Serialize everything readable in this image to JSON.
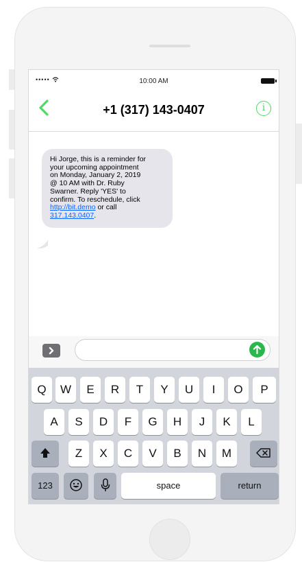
{
  "status_bar": {
    "signal": "••••• ",
    "time": "10:00 AM"
  },
  "nav": {
    "contact": "+1 (317) 143-0407",
    "info_icon": "info-icon"
  },
  "message": {
    "text_lines": [
      "Hi Jorge, this is a reminder for",
      "your upcoming appointment",
      "on Monday, January 2, 2019",
      "@ 10 AM with Dr. Ruby",
      "Swarner. Reply 'YES' to",
      "confirm. To reschedule, click"
    ],
    "link_url": "http://bit.demo",
    "text_or_call": " or call",
    "link_phone": "317.143.0407",
    "trailing": "."
  },
  "keyboard": {
    "row1": [
      "Q",
      "W",
      "E",
      "R",
      "T",
      "Y",
      "U",
      "I",
      "O",
      "P"
    ],
    "row2": [
      "A",
      "S",
      "D",
      "F",
      "G",
      "H",
      "J",
      "K",
      "L"
    ],
    "row3": [
      "Z",
      "X",
      "C",
      "V",
      "B",
      "N",
      "M"
    ],
    "numbers_label": "123",
    "space_label": "space",
    "return_label": "return"
  },
  "colors": {
    "accent": "#4cd964",
    "send": "#2ab84d",
    "bubble": "#e6e5eb",
    "link": "#0b65ff"
  }
}
